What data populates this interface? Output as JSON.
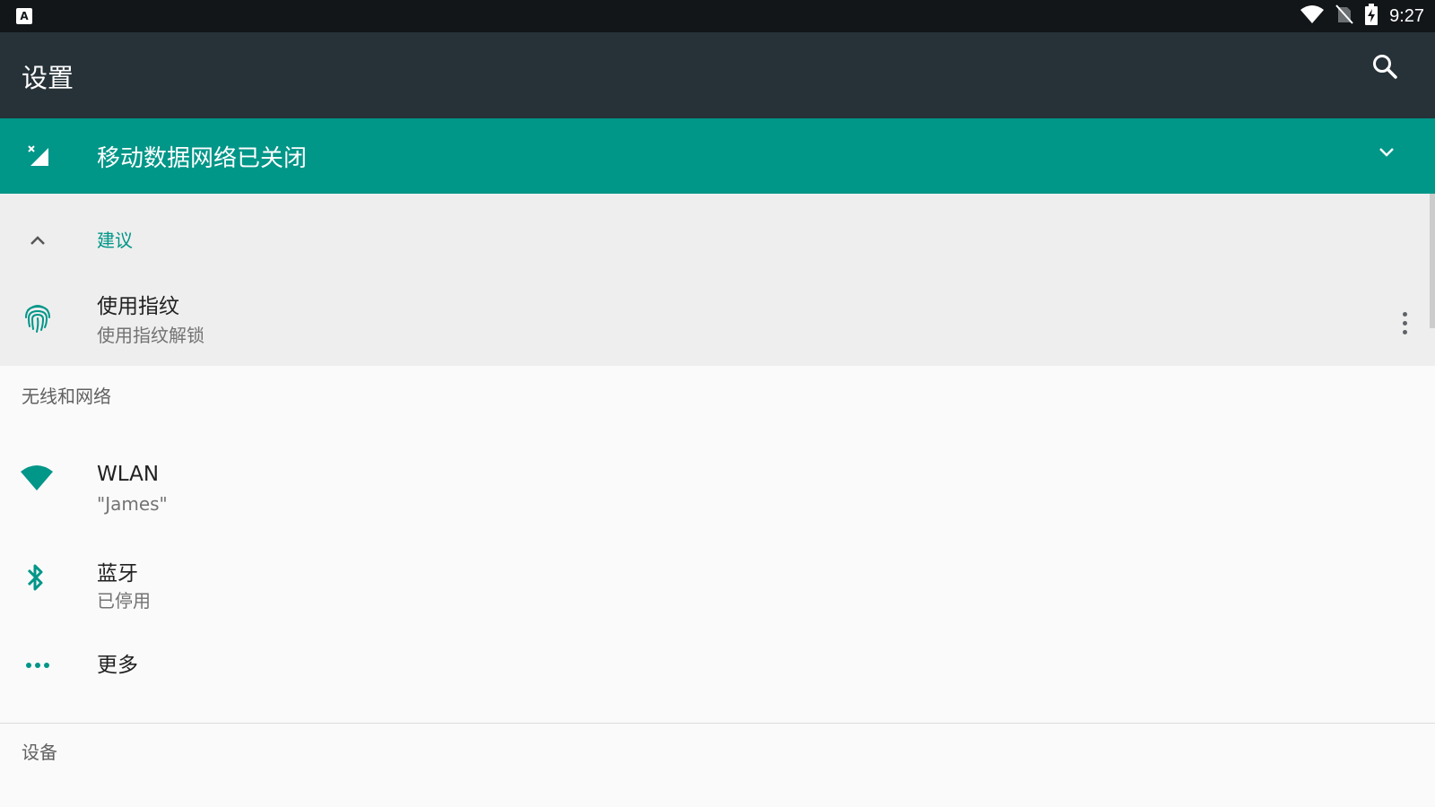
{
  "status_bar": {
    "app_icon_letter": "A",
    "time": "9:27",
    "icons": [
      "wifi-icon",
      "no-sim-icon",
      "battery-charging-icon"
    ]
  },
  "toolbar": {
    "title": "设置",
    "search_icon": "search-icon"
  },
  "condition_card": {
    "title": "移动数据网络已关闭",
    "icon": "cellular-off-icon",
    "expand_icon": "chevron-down-icon"
  },
  "suggestions": {
    "header": "建议",
    "items": [
      {
        "title": "使用指纹",
        "subtitle": "使用指纹解锁",
        "icon": "fingerprint-icon"
      }
    ]
  },
  "categories": [
    {
      "title": "无线和网络",
      "tiles": [
        {
          "title": "WLAN",
          "subtitle": "\"James\"",
          "icon": "wifi-icon"
        },
        {
          "title": "蓝牙",
          "subtitle": "已停用",
          "icon": "bluetooth-icon"
        },
        {
          "title": "更多",
          "subtitle": "",
          "icon": "more-horiz-icon"
        }
      ]
    },
    {
      "title": "设备",
      "tiles": []
    }
  ],
  "colors": {
    "accent": "#009688",
    "toolbar": "#263238",
    "status_bar": "#121619",
    "suggestion_bg": "#eeeeee",
    "background": "#fafafa"
  }
}
